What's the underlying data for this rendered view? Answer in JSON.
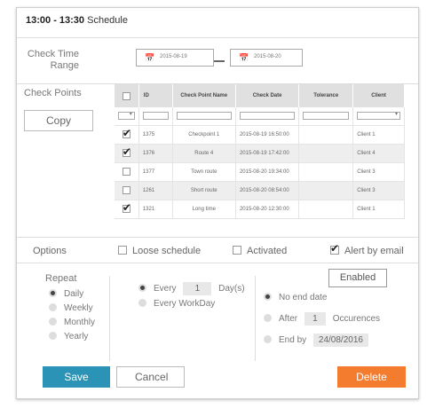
{
  "window": {
    "time_range": "13:00 - 13:30",
    "title": "Schedule"
  },
  "check_time": {
    "label": "Check Time Range",
    "from": "2015-08-19",
    "to": "2015-08-20",
    "calendar_icon": "calendar-icon"
  },
  "check_points": {
    "label": "Check Points",
    "copy_label": "Copy",
    "columns": [
      "ID",
      "Check Point Name",
      "Check Date",
      "Tolerance",
      "Client"
    ],
    "rows": [
      {
        "checked": true,
        "id": "1375",
        "name": "Checkpoint 1",
        "date": "2015-08-19 16:50:00",
        "tolerance": "",
        "client": "Client 1"
      },
      {
        "checked": true,
        "id": "1376",
        "name": "Route 4",
        "date": "2015-08-19 17:42:00",
        "tolerance": "",
        "client": "Client 4"
      },
      {
        "checked": false,
        "id": "1377",
        "name": "Town route",
        "date": "2015-08-20 19:34:00",
        "tolerance": "",
        "client": "Client 3"
      },
      {
        "checked": false,
        "id": "1261",
        "name": "Short route",
        "date": "2015-08-20 08:54:00",
        "tolerance": "",
        "client": "Client 3"
      },
      {
        "checked": true,
        "id": "1321",
        "name": "Long time",
        "date": "2015-08-20 12:30:00",
        "tolerance": "",
        "client": "Client 1"
      }
    ]
  },
  "options": {
    "label": "Options",
    "loose_schedule": "Loose schedule",
    "loose_checked": false,
    "activated": "Activated",
    "activated_checked": false,
    "alert_email": "Alert by email",
    "alert_checked": true
  },
  "repeat": {
    "label": "Repeat",
    "options": [
      "Daily",
      "Weekly",
      "Monthly",
      "Yearly"
    ],
    "selected": "Daily",
    "every_label": "Every",
    "every_value": "1",
    "every_unit": "Day(s)",
    "every_workday": "Every WorkDay"
  },
  "end": {
    "enabled_label": "Enabled",
    "no_end_date": "No end date",
    "after_label": "After",
    "after_value": "1",
    "occurences": "Occurences",
    "end_by_label": "End by",
    "end_by_value": "24/08/2016"
  },
  "actions": {
    "save": "Save",
    "cancel": "Cancel",
    "delete": "Delete"
  },
  "colors": {
    "save": "#2b93b5",
    "delete": "#f47c2e",
    "header": "#e0e0e0"
  }
}
